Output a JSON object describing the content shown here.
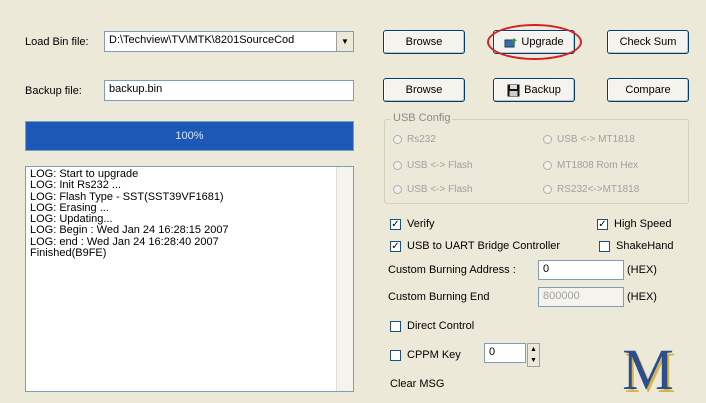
{
  "load_bin": {
    "label": "Load Bin file:",
    "value": "D:\\Techview\\TV\\MTK\\8201SourceCod",
    "dropdown_icon": "chevron-down-icon"
  },
  "backup_file": {
    "label": "Backup file:",
    "value": "backup.bin"
  },
  "progress": {
    "text": "100%",
    "value": 1.0,
    "fill_color": "#1c58b6"
  },
  "log": {
    "lines": [
      "LOG: Start to upgrade",
      "LOG: Init Rs232 ...",
      "LOG: Flash Type - SST(SST39VF1681)",
      "LOG: Erasing ...",
      "LOG: Updating...",
      "LOG: Begin : Wed Jan 24 16:28:15 2007",
      "LOG: end : Wed Jan 24 16:28:40 2007",
      "Finished(B9FE)"
    ]
  },
  "buttons": {
    "browse_1": "Browse",
    "upgrade": "Upgrade",
    "check_sum": "Check Sum",
    "browse_2": "Browse",
    "backup": "Backup",
    "compare": "Compare"
  },
  "icons": {
    "upgrade_icon": "upgrade-chip-icon",
    "backup_icon": "floppy-disk-icon"
  },
  "usb_config": {
    "title": "USB Config",
    "options": [
      "Rs232",
      "USB <-> MT1818",
      "USB <-> Flash",
      "MT1808 Rom Hex",
      "USB <-> Flash",
      "RS232<->MT1818"
    ]
  },
  "checks": {
    "verify": "Verify",
    "high_speed": "High Speed",
    "usb_uart": "USB to UART Bridge Controller",
    "shake_hand": "ShakeHand",
    "direct_control": "Direct Control",
    "cppm_key": "CPPM Key"
  },
  "custom": {
    "burning_address_label": "Custom Burning Address :",
    "burning_address_value": "0",
    "burning_end_label": "Custom Burning End",
    "burning_end_value": "800000",
    "hex_unit": "(HEX)"
  },
  "cppm_value": "0",
  "clear_msg": "Clear MSG",
  "logo_letter": "M",
  "accent_ring_color": "#d22222"
}
